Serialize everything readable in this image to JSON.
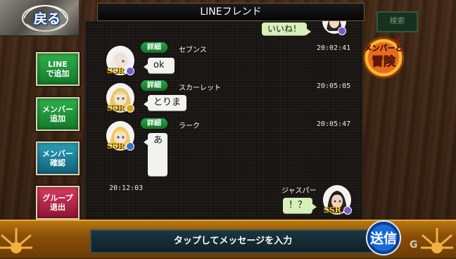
{
  "header": {
    "title": "LINEフレンド",
    "back_label": "戻る",
    "search_label": "検索"
  },
  "sidebar": {
    "buttons": [
      {
        "line1": "LINE",
        "line2": "で追加",
        "color": "#1f9a3b"
      },
      {
        "line1": "メンバー",
        "line2": "追加",
        "color": "#1f9a3b"
      },
      {
        "line1": "メンバー",
        "line2": "確認",
        "color": "#1b86a0"
      },
      {
        "line1": "グループ",
        "line2": "退出",
        "color": "#b5254a"
      }
    ]
  },
  "emblem": {
    "line1": "メンバーと",
    "line2": "冒険"
  },
  "messages": [
    {
      "side": "right",
      "text": "いいね！",
      "partial": true
    },
    {
      "side": "left",
      "sender": "セブンス",
      "time": "20:02:41",
      "detail": "詳細",
      "text": "ok",
      "rarity": "SSR"
    },
    {
      "side": "left",
      "sender": "スカーレット",
      "time": "20:05:05",
      "detail": "詳細",
      "text": "とりま",
      "rarity": "SSR"
    },
    {
      "side": "left",
      "sender": "ラーク",
      "time": "20:05:47",
      "detail": "詳細",
      "text": "あ",
      "rarity": "SSR"
    },
    {
      "side": "right",
      "sender": "ジャスパー",
      "time": "20:12:03",
      "text": "！？",
      "rarity": "SSR"
    }
  ],
  "input": {
    "placeholder": "タップしてメッセージを入力"
  },
  "send_button": {
    "label": "送信"
  },
  "watermark": {
    "text": "G"
  },
  "colors": {
    "accent_green": "#1f9a3b",
    "send_blue": "#1260c8",
    "panel_bg": "#171310"
  }
}
